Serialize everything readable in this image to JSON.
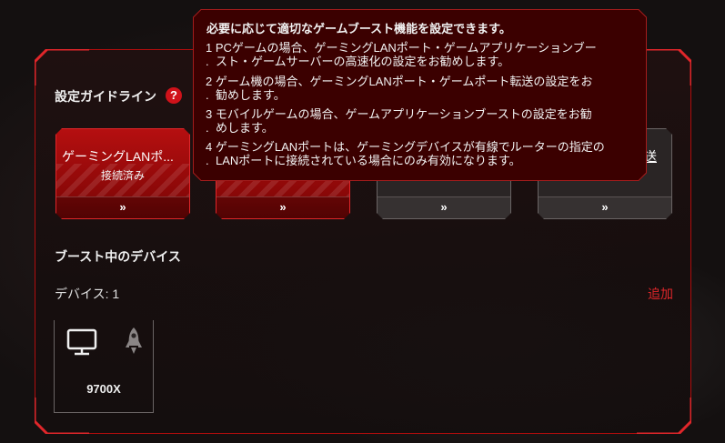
{
  "guide": {
    "title": "設定ガイドライン",
    "help_icon": "question-icon"
  },
  "cards": [
    {
      "label": "ゲーミングLANポ...",
      "status": "接続済み",
      "action": "»",
      "style": "active"
    },
    {
      "label": "",
      "status": "",
      "action": "»",
      "style": "active"
    },
    {
      "label": "",
      "status": "",
      "action": "»",
      "style": "inactive"
    },
    {
      "label": "送",
      "status": "",
      "action": "»",
      "style": "inactive"
    }
  ],
  "boost": {
    "section_title": "ブースト中のデバイス",
    "device_count": "デバイス: 1",
    "add_label": "追加",
    "devices": [
      {
        "name": "9700X",
        "icon": "monitor-icon",
        "boost_icon": "rocket-icon"
      }
    ]
  },
  "tooltip": {
    "heading": "必要に応じて適切なゲームブースト機能を設定できます。",
    "items": [
      {
        "line1": "1 PCゲームの場合、ゲーミングLANポート・ゲームアプリケーションブー",
        "line2": "スト・ゲームサーバーの高速化の設定をお勧めします。"
      },
      {
        "line1": "2 ゲーム機の場合、ゲーミングLANポート・ゲームポート転送の設定をお",
        "line2": "勧めします。"
      },
      {
        "line1": "3 モバイルゲームの場合、ゲームアプリケーションブーストの設定をお勧",
        "line2": "めします。"
      },
      {
        "line1": "4 ゲーミングLANポートは、ゲーミングデバイスが有線でルーターの指定の",
        "line2": "LANポートに接続されている場合にのみ有効になります。"
      }
    ]
  },
  "colors": {
    "accent_red": "#d0121a",
    "panel_border": "#b10d0d",
    "tooltip_bg": "#3b0000",
    "link_red": "#e0262a"
  }
}
